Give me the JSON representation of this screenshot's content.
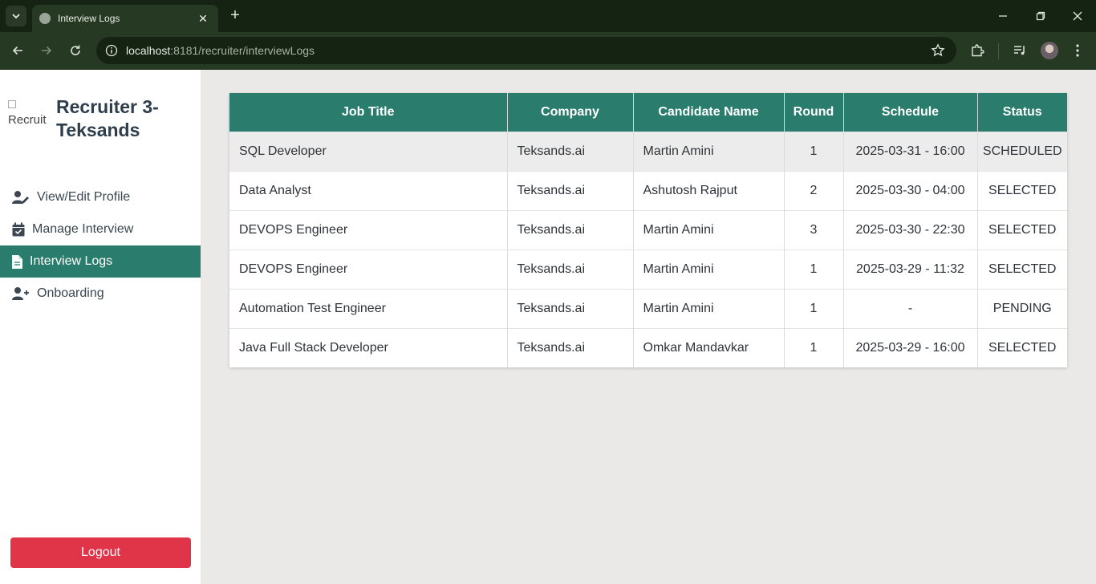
{
  "browser": {
    "tab_title": "Interview Logs",
    "url_host": "localhost",
    "url_rest": ":8181/recruiter/interviewLogs"
  },
  "sidebar": {
    "brand_alt": "Recruit",
    "brand_title": "Recruiter 3-Teksands",
    "items": [
      {
        "label": "View/Edit Profile",
        "icon": "user-edit-icon",
        "active": false
      },
      {
        "label": "Manage Interview",
        "icon": "calendar-check-icon",
        "active": false
      },
      {
        "label": "Interview Logs",
        "icon": "file-lines-icon",
        "active": true
      },
      {
        "label": "Onboarding",
        "icon": "user-plus-icon",
        "active": false
      }
    ],
    "logout_label": "Logout"
  },
  "table": {
    "columns": [
      "Job Title",
      "Company",
      "Candidate Name",
      "Round",
      "Schedule",
      "Status"
    ],
    "rows": [
      [
        "SQL Developer",
        "Teksands.ai",
        "Martin Amini",
        "1",
        "2025-03-31 - 16:00",
        "SCHEDULED"
      ],
      [
        "Data Analyst",
        "Teksands.ai",
        "Ashutosh Rajput",
        "2",
        "2025-03-30 - 04:00",
        "SELECTED"
      ],
      [
        "DEVOPS Engineer",
        "Teksands.ai",
        "Martin Amini",
        "3",
        "2025-03-30 - 22:30",
        "SELECTED"
      ],
      [
        "DEVOPS Engineer",
        "Teksands.ai",
        "Martin Amini",
        "1",
        "2025-03-29 - 11:32",
        "SELECTED"
      ],
      [
        "Automation Test Engineer",
        "Teksands.ai",
        "Martin Amini",
        "1",
        "-",
        "PENDING"
      ],
      [
        "Java Full Stack Developer",
        "Teksands.ai",
        "Omkar Mandavkar",
        "1",
        "2025-03-29 - 16:00",
        "SELECTED"
      ]
    ]
  },
  "colors": {
    "accent": "#2a7d6d",
    "logout": "#e03548",
    "page_bg": "#ebe9e7"
  }
}
